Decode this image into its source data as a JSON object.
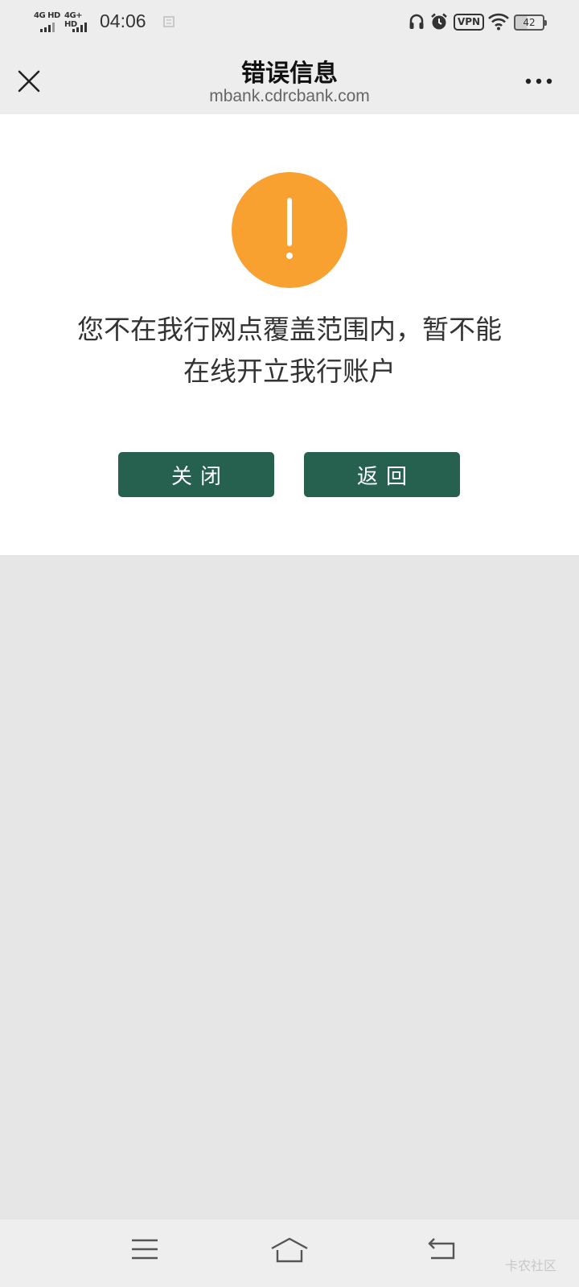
{
  "status_bar": {
    "sim1_label": "4G HD",
    "sim2_label": "4G+ HD",
    "time": "04:06",
    "vpn_label": "VPN",
    "battery_level": "42"
  },
  "header": {
    "title": "错误信息",
    "subtitle": "mbank.cdrcbank.com"
  },
  "content": {
    "icon": "exclamation-circle-icon",
    "message_line1": "您不在我行网点覆盖范围内，暂不能",
    "message_line2": "在线开立我行账户",
    "close_button": "关闭",
    "back_button": "返回"
  },
  "bottom_bar": {
    "watermark": "卡农社区"
  },
  "colors": {
    "accent_button": "#266150",
    "warning_icon": "#f8a030",
    "background": "#e6e6e6"
  }
}
